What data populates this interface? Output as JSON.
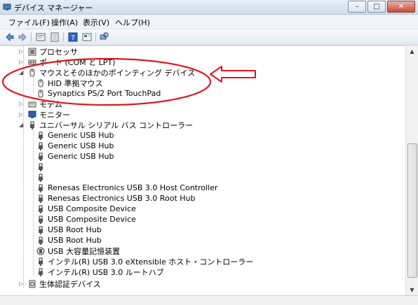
{
  "window": {
    "title": "デバイス マネージャー",
    "controls": {
      "minimize": "–",
      "maximize": "□",
      "close": "✕"
    }
  },
  "menu": {
    "items": [
      {
        "label": "ファイル(F)"
      },
      {
        "label": "操作(A)"
      },
      {
        "label": "表示(V)"
      },
      {
        "label": "ヘルプ(H)"
      }
    ]
  },
  "toolbar": {
    "icons": [
      "back-arrow-icon",
      "forward-arrow-icon",
      "properties-icon",
      "update-driver-icon",
      "help-icon",
      "view-icon",
      "scan-hardware-icon"
    ]
  },
  "tree": {
    "categories": [
      {
        "label": "プロセッサ",
        "icon": "processor-icon",
        "expanded": false
      },
      {
        "label": "ポート (COM と LPT)",
        "icon": "port-icon",
        "expanded": false
      },
      {
        "label": "マウスとそのほかのポインティング デバイス",
        "icon": "mouse-icon",
        "expanded": true,
        "children": [
          {
            "label": "HID 準拠マウス",
            "icon": "mouse-icon"
          },
          {
            "label": "Synaptics PS/2 Port TouchPad",
            "icon": "mouse-icon"
          }
        ]
      },
      {
        "label": "モデム",
        "icon": "modem-icon",
        "expanded": false
      },
      {
        "label": "モニター",
        "icon": "monitor-icon",
        "expanded": false
      },
      {
        "label": "ユニバーサル シリアル バス コントローラー",
        "icon": "usb-icon",
        "expanded": true,
        "children": [
          {
            "label": "Generic USB Hub",
            "icon": "usb-icon"
          },
          {
            "label": "Generic USB Hub",
            "icon": "usb-icon"
          },
          {
            "label": "Generic USB Hub",
            "icon": "usb-icon"
          },
          {
            "label": "",
            "icon": "usb-icon"
          },
          {
            "label": "",
            "icon": "usb-icon"
          },
          {
            "label": "Renesas Electronics USB 3.0 Host Controller",
            "icon": "usb-icon"
          },
          {
            "label": "Renesas Electronics USB 3.0 Root Hub",
            "icon": "usb-icon"
          },
          {
            "label": "USB Composite Device",
            "icon": "usb-icon"
          },
          {
            "label": "USB Composite Device",
            "icon": "usb-icon"
          },
          {
            "label": "USB Root Hub",
            "icon": "usb-icon"
          },
          {
            "label": "USB Root Hub",
            "icon": "usb-icon"
          },
          {
            "label": "USB 大容量記憶装置",
            "icon": "usb-storage-icon"
          },
          {
            "label": "インテル(R) USB 3.0 eXtensible ホスト・コントローラー",
            "icon": "usb-icon"
          },
          {
            "label": "インテル(R) USB 3.0 ルートハブ",
            "icon": "usb-icon"
          }
        ]
      },
      {
        "label": "生体認証デバイス",
        "icon": "biometric-icon",
        "expanded": false
      }
    ]
  },
  "annotation": {
    "color": "#e0141e"
  }
}
